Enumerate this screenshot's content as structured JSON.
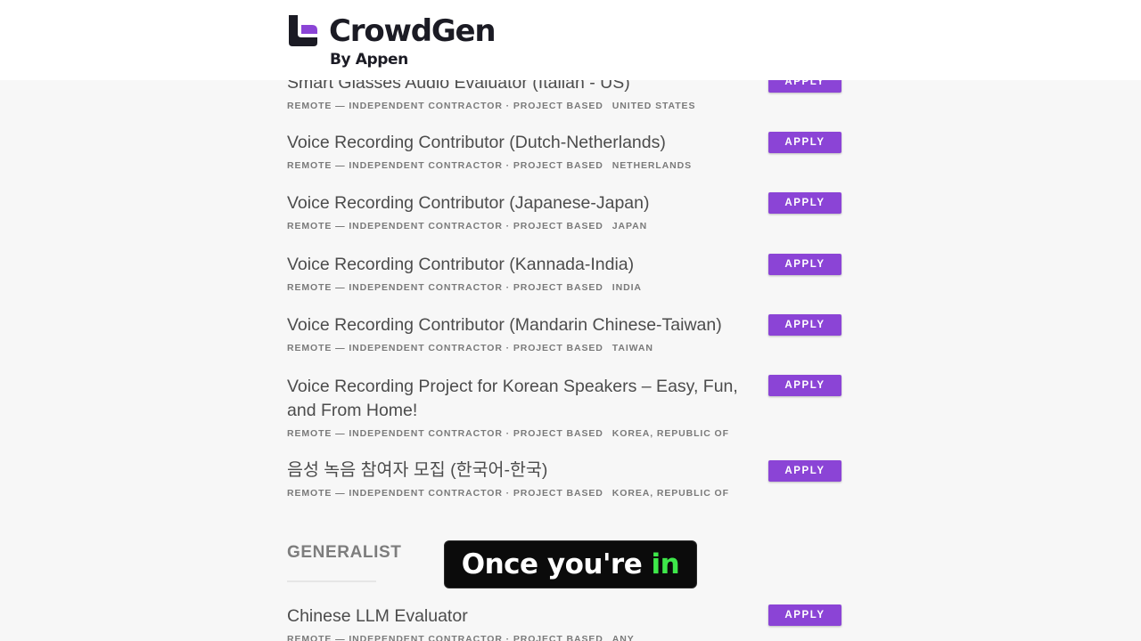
{
  "brand": {
    "name": "CrowdGen",
    "sub": "By Appen",
    "accent_color": "#8b44d6"
  },
  "jobs": [
    {
      "title": "Smart Glasses Audio Evaluator (Italian - US)",
      "meta": "REMOTE — INDEPENDENT CONTRACTOR · PROJECT BASED",
      "location": "UNITED STATES",
      "button": "APPLY"
    },
    {
      "title": "Voice Recording Contributor (Dutch-Netherlands)",
      "meta": "REMOTE — INDEPENDENT CONTRACTOR · PROJECT BASED",
      "location": "NETHERLANDS",
      "button": "APPLY"
    },
    {
      "title": "Voice Recording Contributor (Japanese-Japan)",
      "meta": "REMOTE — INDEPENDENT CONTRACTOR · PROJECT BASED",
      "location": "JAPAN",
      "button": "APPLY"
    },
    {
      "title": "Voice Recording Contributor (Kannada-India)",
      "meta": "REMOTE — INDEPENDENT CONTRACTOR · PROJECT BASED",
      "location": "INDIA",
      "button": "APPLY"
    },
    {
      "title": "Voice Recording Contributor (Mandarin Chinese-Taiwan)",
      "meta": "REMOTE — INDEPENDENT CONTRACTOR · PROJECT BASED",
      "location": "TAIWAN",
      "button": "APPLY"
    },
    {
      "title": "Voice Recording Project for Korean Speakers – Easy, Fun, and From Home!",
      "meta": "REMOTE — INDEPENDENT CONTRACTOR · PROJECT BASED",
      "location": "KOREA, REPUBLIC OF",
      "button": "APPLY"
    },
    {
      "title": "음성 녹음 참여자 모집 (한국어-한국)",
      "meta": "REMOTE — INDEPENDENT CONTRACTOR · PROJECT BASED",
      "location": "KOREA, REPUBLIC OF",
      "button": "APPLY"
    }
  ],
  "generalist": {
    "heading": "GENERALIST",
    "jobs": [
      {
        "title": "Chinese LLM Evaluator",
        "meta": "REMOTE — INDEPENDENT CONTRACTOR · PROJECT BASED",
        "location": "ANY",
        "button": "APPLY"
      }
    ]
  },
  "caption": {
    "text": "Once you're",
    "highlight": "in",
    "highlight_color": "#3ee84a"
  }
}
